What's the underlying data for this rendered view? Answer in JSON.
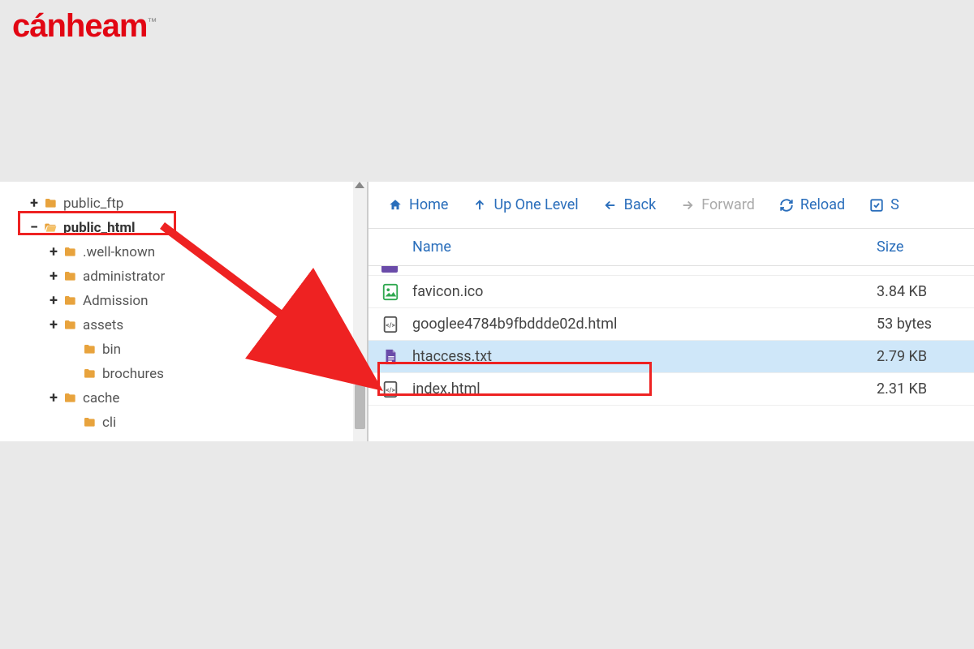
{
  "logo_text": "cánheam",
  "logo_tm": "™",
  "tree": {
    "items": [
      {
        "label": "public_ftp",
        "toggle": "+",
        "depth": 0,
        "selected": false,
        "open": false
      },
      {
        "label": "public_html",
        "toggle": "−",
        "depth": 0,
        "selected": true,
        "open": true
      },
      {
        "label": ".well-known",
        "toggle": "+",
        "depth": 1,
        "selected": false,
        "open": false
      },
      {
        "label": "administrator",
        "toggle": "+",
        "depth": 1,
        "selected": false,
        "open": false
      },
      {
        "label": "Admission",
        "toggle": "+",
        "depth": 1,
        "selected": false,
        "open": false
      },
      {
        "label": "assets",
        "toggle": "+",
        "depth": 1,
        "selected": false,
        "open": false
      },
      {
        "label": "bin",
        "toggle": "",
        "depth": 2,
        "selected": false,
        "open": false
      },
      {
        "label": "brochures",
        "toggle": "",
        "depth": 2,
        "selected": false,
        "open": false
      },
      {
        "label": "cache",
        "toggle": "+",
        "depth": 1,
        "selected": false,
        "open": false
      },
      {
        "label": "cli",
        "toggle": "",
        "depth": 2,
        "selected": false,
        "open": false
      }
    ]
  },
  "toolbar": {
    "home": "Home",
    "up": "Up One Level",
    "back": "Back",
    "forward": "Forward",
    "reload": "Reload",
    "select": "S"
  },
  "columns": {
    "name": "Name",
    "size": "Size"
  },
  "files": [
    {
      "name": "favicon.ico",
      "size": "3.84 KB",
      "type": "image",
      "selected": false
    },
    {
      "name": "googlee4784b9fbddde02d.html",
      "size": "53 bytes",
      "type": "code",
      "selected": false
    },
    {
      "name": "htaccess.txt",
      "size": "2.79 KB",
      "type": "doc",
      "selected": true
    },
    {
      "name": "index.html",
      "size": "2.31 KB",
      "type": "code",
      "selected": false
    }
  ]
}
